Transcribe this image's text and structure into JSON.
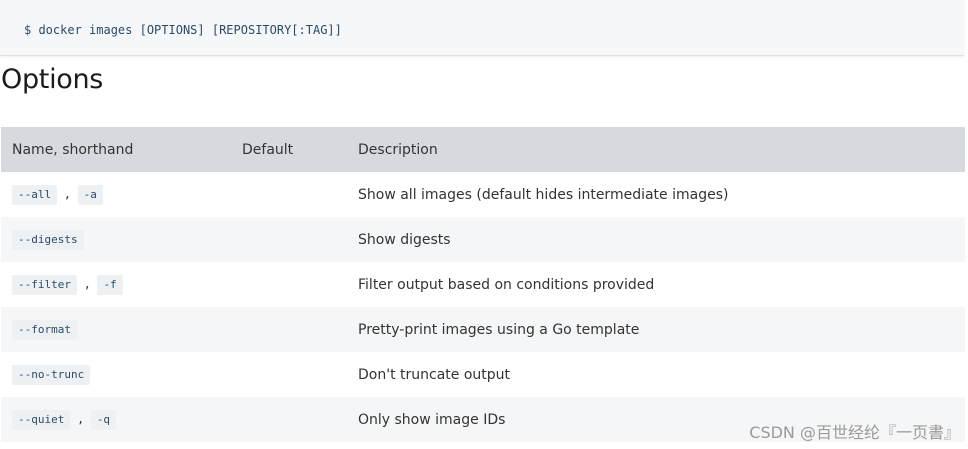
{
  "usage": {
    "command": "$ docker images [OPTIONS] [REPOSITORY[:TAG]]"
  },
  "section": {
    "title": "Options"
  },
  "table": {
    "headers": {
      "name": "Name, shorthand",
      "default": "Default",
      "description": "Description"
    },
    "rows": [
      {
        "name": "--all",
        "shorthand": "-a",
        "separator": ",",
        "default": "",
        "description": "Show all images (default hides intermediate images)"
      },
      {
        "name": "--digests",
        "shorthand": "",
        "separator": "",
        "default": "",
        "description": "Show digests"
      },
      {
        "name": "--filter",
        "shorthand": "-f",
        "separator": ",",
        "default": "",
        "description": "Filter output based on conditions provided"
      },
      {
        "name": "--format",
        "shorthand": "",
        "separator": "",
        "default": "",
        "description": "Pretty-print images using a Go template"
      },
      {
        "name": "--no-trunc",
        "shorthand": "",
        "separator": "",
        "default": "",
        "description": "Don't truncate output"
      },
      {
        "name": "--quiet",
        "shorthand": "-q",
        "separator": ",",
        "default": "",
        "description": "Only show image IDs"
      }
    ]
  },
  "watermark": "CSDN @百世经纶『一页書』"
}
